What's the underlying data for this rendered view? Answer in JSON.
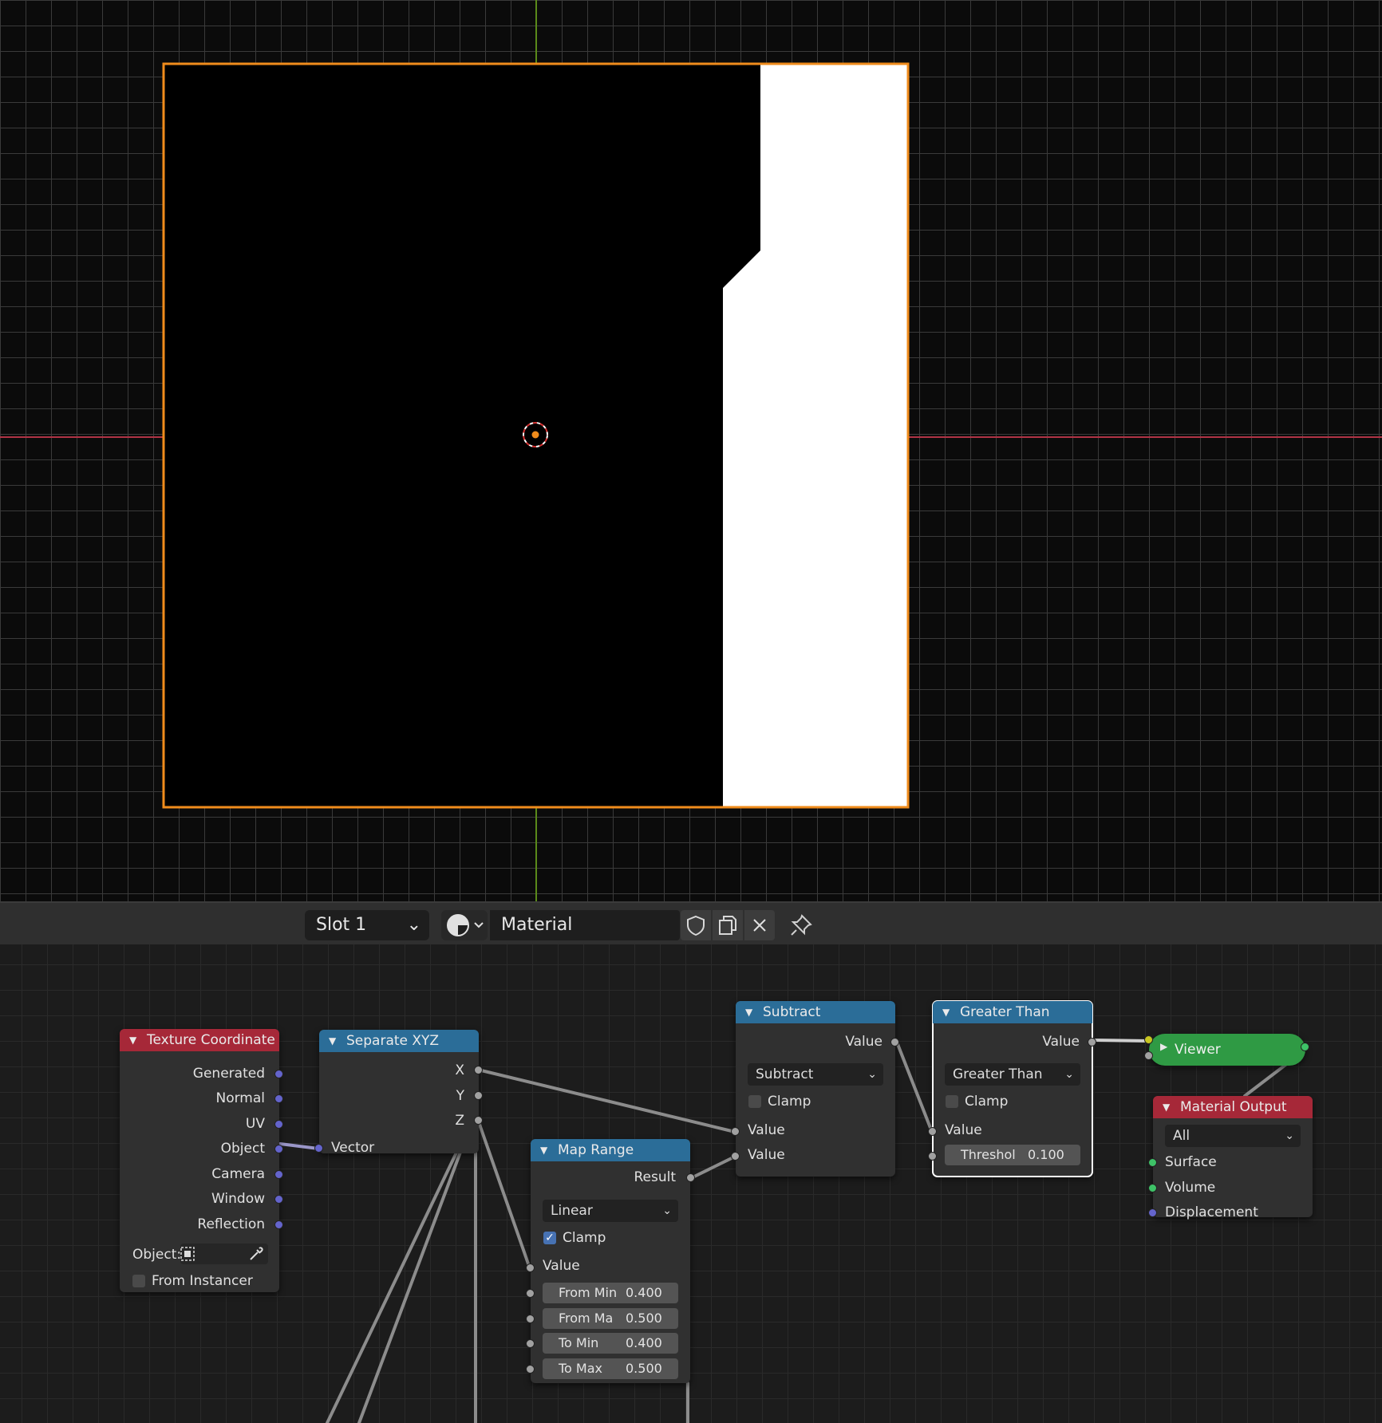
{
  "header": {
    "slot_label": "Slot 1",
    "material_name": "Material",
    "icons": [
      "sphere-shading-icon",
      "shield-icon",
      "copy-icon",
      "close-icon",
      "pin-icon"
    ]
  },
  "nodes": {
    "texture_coordinate": {
      "title": "Texture Coordinate",
      "outputs": [
        "Generated",
        "Normal",
        "UV",
        "Object",
        "Camera",
        "Window",
        "Reflection"
      ],
      "object_label": "Object:",
      "from_instancer": "From Instancer"
    },
    "separate_xyz": {
      "title": "Separate XYZ",
      "outputs": [
        "X",
        "Y",
        "Z"
      ],
      "input": "Vector"
    },
    "map_range": {
      "title": "Map Range",
      "output": "Result",
      "mode": "Linear",
      "clamp_label": "Clamp",
      "input": "Value",
      "fields": [
        {
          "label": "From Min",
          "value": "0.400"
        },
        {
          "label": "From Ma",
          "value": "0.500"
        },
        {
          "label": "To Min",
          "value": "0.400"
        },
        {
          "label": "To Max",
          "value": "0.500"
        }
      ]
    },
    "subtract": {
      "title": "Subtract",
      "output": "Value",
      "operation": "Subtract",
      "clamp_label": "Clamp",
      "inputs": [
        "Value",
        "Value"
      ]
    },
    "greater_than": {
      "title": "Greater Than",
      "output": "Value",
      "operation": "Greater Than",
      "clamp_label": "Clamp",
      "input": "Value",
      "threshold_label": "Threshol",
      "threshold_value": "0.100"
    },
    "viewer": {
      "title": "Viewer"
    },
    "material_output": {
      "title": "Material Output",
      "target": "All",
      "inputs": [
        "Surface",
        "Volume",
        "Displacement"
      ]
    }
  },
  "colors": {
    "input_header": "#a62838",
    "converter_header": "#2b6d98",
    "viewer": "#2f9a44",
    "selection_outline": "#f08c1c",
    "vector_socket": "#6464cc",
    "value_socket": "#a1a1a1",
    "shader_socket": "#3ec267"
  }
}
